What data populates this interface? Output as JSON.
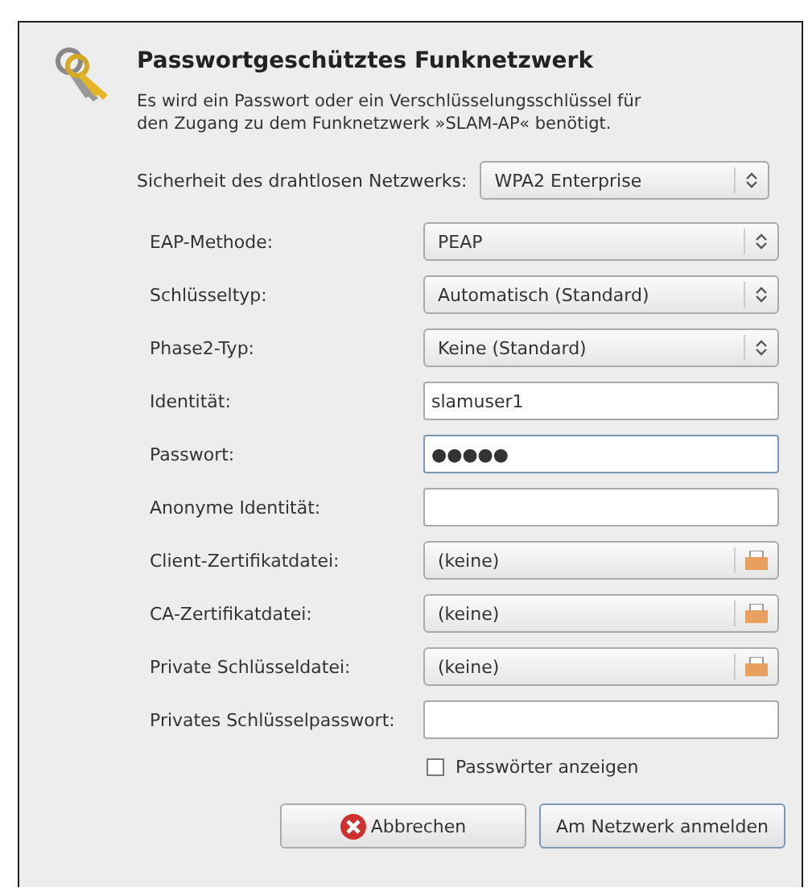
{
  "dialog": {
    "title": "Passwortgeschütztes Funknetzwerk",
    "message": "Es wird ein Passwort oder ein Verschlüsselungsschlüssel für den Zugang zu dem Funknetzwerk »SLAM-AP« benötigt."
  },
  "security": {
    "label": "Sicherheit des drahtlosen Netzwerks:",
    "value": "WPA2 Enterprise"
  },
  "fields": [
    {
      "kind": "combo",
      "label": "EAP-Methode:",
      "value": "PEAP"
    },
    {
      "kind": "combo",
      "label": "Schlüsseltyp:",
      "value": "Automatisch (Standard)"
    },
    {
      "kind": "combo",
      "label": "Phase2-Typ:",
      "value": "Keine (Standard)"
    },
    {
      "kind": "entry",
      "label": "Identität:",
      "value": "slamuser1",
      "focused": false
    },
    {
      "kind": "entry",
      "label": "Passwort:",
      "value": "●●●●●",
      "focused": true
    },
    {
      "kind": "entry",
      "label": "Anonyme Identität:",
      "focused": false
    },
    {
      "kind": "file",
      "label": "Client-Zertifikatdatei:",
      "value": "(keine)"
    },
    {
      "kind": "file",
      "label": "CA-Zertifikatdatei:",
      "value": "(keine)"
    },
    {
      "kind": "file",
      "label": "Private Schlüsseldatei:",
      "value": "(keine)"
    },
    {
      "kind": "entry",
      "label": "Privates Schlüsselpasswort:",
      "focused": false
    }
  ],
  "show_passwords": {
    "label": "Passwörter anzeigen",
    "checked": false
  },
  "buttons": [
    {
      "kind": "cancel",
      "label": "Abbrechen"
    },
    {
      "kind": "default",
      "label": "Am Netzwerk anmelden"
    }
  ]
}
